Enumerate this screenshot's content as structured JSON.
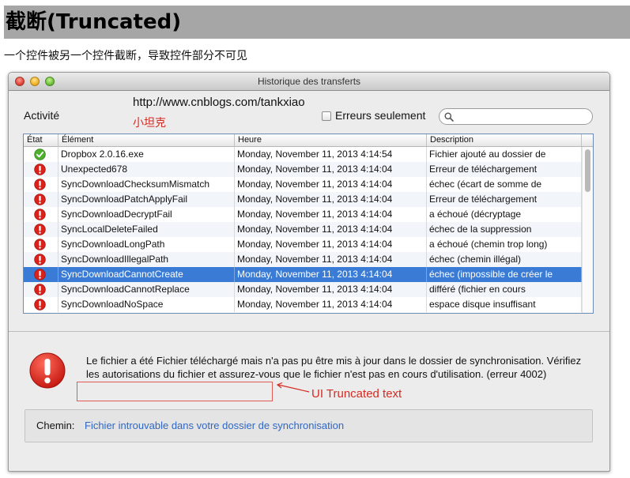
{
  "doc": {
    "title": "截断(Truncated)",
    "subtitle": "一个控件被另一个控件截断，导致控件部分不可见"
  },
  "window": {
    "title": "Historique des transferts",
    "activity_label": "Activité",
    "url": "http://www.cnblogs.com/tankxiao",
    "cn_label": "小坦克",
    "errors_only_label": "Erreurs seulement",
    "errors_only_checked": false,
    "search": {
      "value": "",
      "placeholder": ""
    }
  },
  "table": {
    "columns": [
      "État",
      "Élément",
      "Heure",
      "Description"
    ],
    "rows": [
      {
        "status": "ok",
        "element": "Dropbox 2.0.16.exe",
        "time": "Monday, November 11, 2013 4:14:54",
        "description": "Fichier ajouté au dossier de",
        "selected": false
      },
      {
        "status": "error",
        "element": "Unexpected678",
        "time": "Monday, November 11, 2013 4:14:04",
        "description": "Erreur de téléchargement",
        "selected": false
      },
      {
        "status": "error",
        "element": "SyncDownloadChecksumMismatch",
        "time": "Monday, November 11, 2013 4:14:04",
        "description": "échec (écart de somme de",
        "selected": false
      },
      {
        "status": "error",
        "element": "SyncDownloadPatchApplyFail",
        "time": "Monday, November 11, 2013 4:14:04",
        "description": "Erreur de téléchargement",
        "selected": false
      },
      {
        "status": "error",
        "element": "SyncDownloadDecryptFail",
        "time": "Monday, November 11, 2013 4:14:04",
        "description": "a échoué (décryptage",
        "selected": false
      },
      {
        "status": "error",
        "element": "SyncLocalDeleteFailed",
        "time": "Monday, November 11, 2013 4:14:04",
        "description": "échec de la suppression",
        "selected": false
      },
      {
        "status": "error",
        "element": "SyncDownloadLongPath",
        "time": "Monday, November 11, 2013 4:14:04",
        "description": "a échoué (chemin trop long)",
        "selected": false
      },
      {
        "status": "error",
        "element": "SyncDownloadIllegalPath",
        "time": "Monday, November 11, 2013 4:14:04",
        "description": "échec (chemin illégal)",
        "selected": false
      },
      {
        "status": "error",
        "element": "SyncDownloadCannotCreate",
        "time": "Monday, November 11, 2013 4:14:04",
        "description": "échec (impossible de créer le",
        "selected": true
      },
      {
        "status": "error",
        "element": "SyncDownloadCannotReplace",
        "time": "Monday, November 11, 2013 4:14:04",
        "description": "différé (fichier en cours",
        "selected": false
      },
      {
        "status": "error",
        "element": "SyncDownloadNoSpace",
        "time": "Monday, November 11, 2013 4:14:04",
        "description": "espace disque insuffisant",
        "selected": false
      }
    ]
  },
  "details": {
    "message": "Le fichier a été Fichier téléchargé mais n'a pas pu être mis à jour dans le dossier de synchronisation. Vérifiez les autorisations du fichier et assurez-vous que le fichier n'est pas en cours d'utilisation. (erreur 4002)",
    "truncation_annotation": "UI Truncated text",
    "path_label": "Chemin:",
    "path_value": "Fichier introuvable dans votre dossier de synchronisation"
  },
  "icons": {
    "ok": "check-circle-icon",
    "error": "exclamation-circle-icon",
    "search": "search-icon"
  },
  "colors": {
    "selection": "#3a7bd5",
    "error_red": "#d42a22",
    "ok_green": "#4caf2d",
    "link_blue": "#3067c4",
    "header_band": "#a6a6a6"
  }
}
